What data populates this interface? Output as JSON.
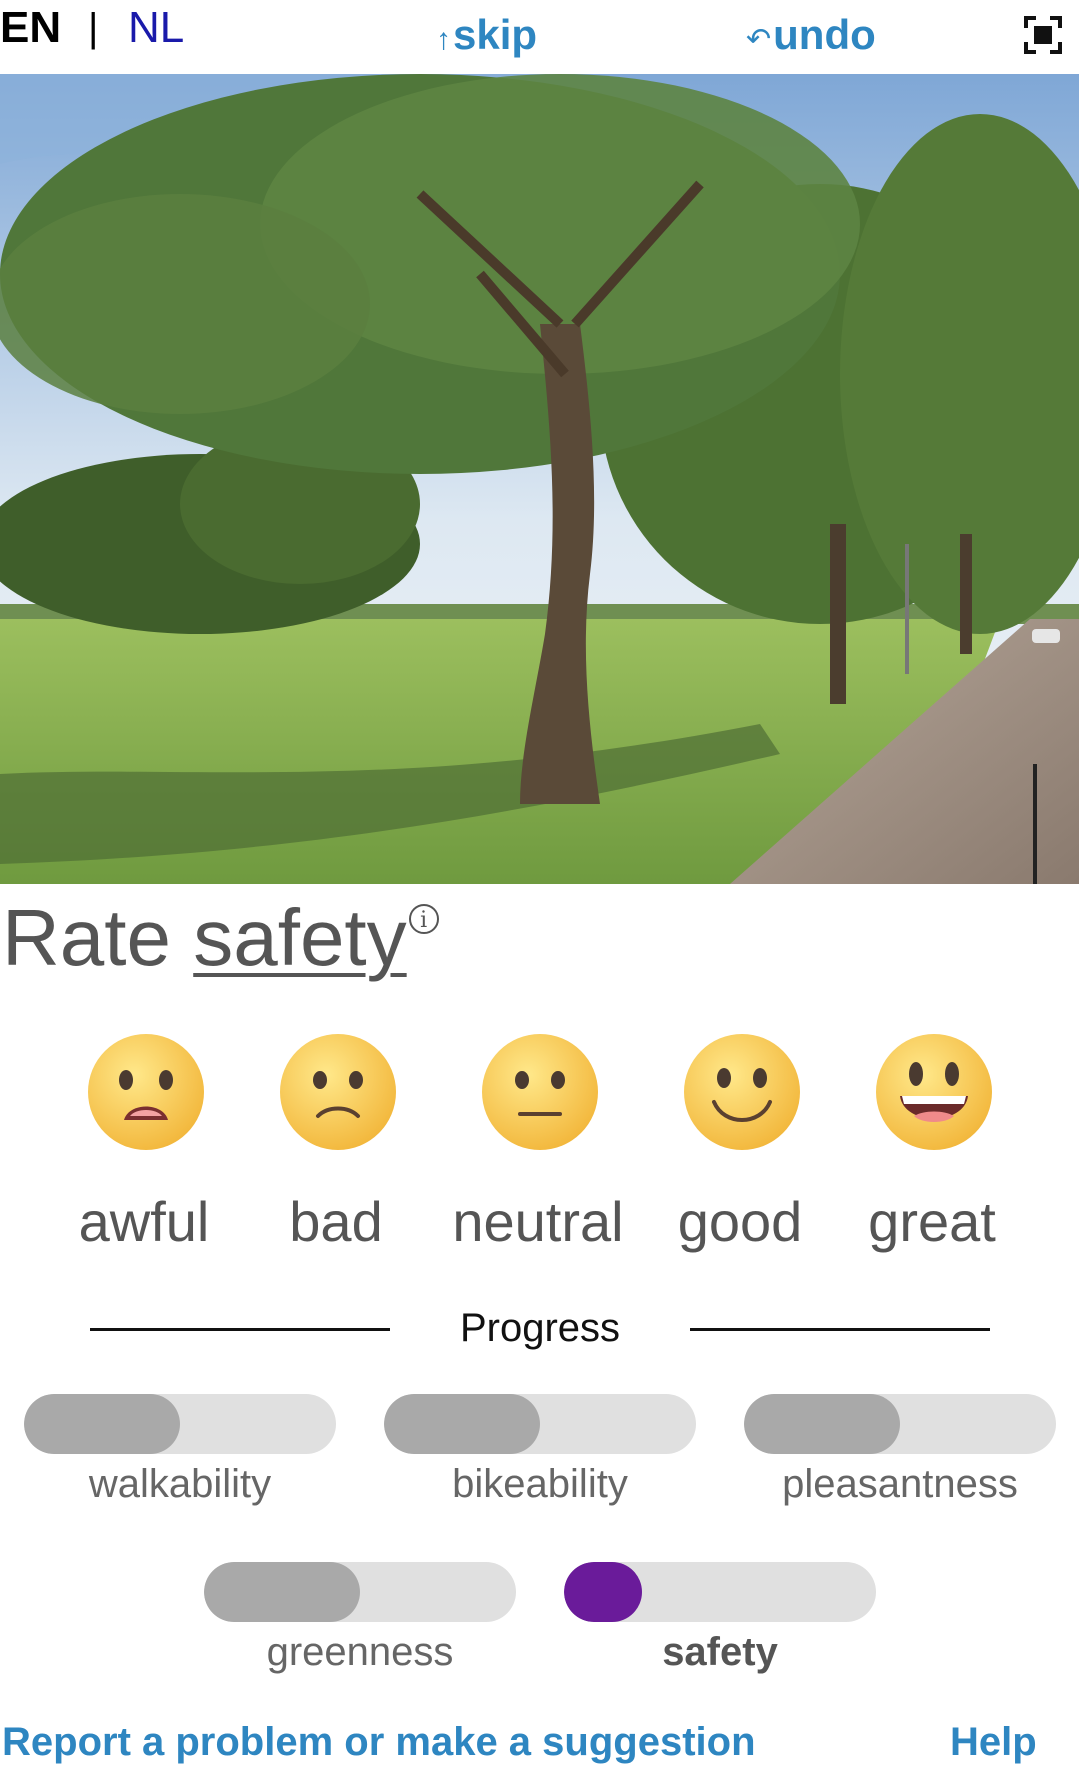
{
  "header": {
    "lang_en": "EN",
    "lang_sep": "|",
    "lang_nl": "NL",
    "skip_glyph": "↑",
    "skip_label": "skip",
    "undo_glyph": "↶",
    "undo_label": "undo",
    "fullscreen_icon": "fullscreen-icon"
  },
  "photo": {
    "description_icon": "street-panorama-photo"
  },
  "prompt": {
    "rate": "Rate",
    "topic": "safety",
    "info_glyph": "i"
  },
  "ratings": [
    {
      "label": "awful",
      "icon": "awful-face-icon"
    },
    {
      "label": "bad",
      "icon": "bad-face-icon"
    },
    {
      "label": "neutral",
      "icon": "neutral-face-icon"
    },
    {
      "label": "good",
      "icon": "good-face-icon"
    },
    {
      "label": "great",
      "icon": "great-face-icon"
    }
  ],
  "progress": {
    "title": "Progress",
    "items": [
      {
        "label": "walkability",
        "fraction": 0.5,
        "active": false
      },
      {
        "label": "bikeability",
        "fraction": 0.5,
        "active": false
      },
      {
        "label": "pleasantness",
        "fraction": 0.5,
        "active": false
      },
      {
        "label": "greenness",
        "fraction": 0.5,
        "active": false
      },
      {
        "label": "safety",
        "fraction": 0.25,
        "active": true
      }
    ]
  },
  "footer": {
    "report_label": "Report a problem or make a suggestion",
    "help_label": "Help"
  },
  "colors": {
    "link": "#2e86c1",
    "active_progress": "#6a1b9a",
    "inactive_progress": "#a9a9a9",
    "track": "#e0e0e0"
  }
}
